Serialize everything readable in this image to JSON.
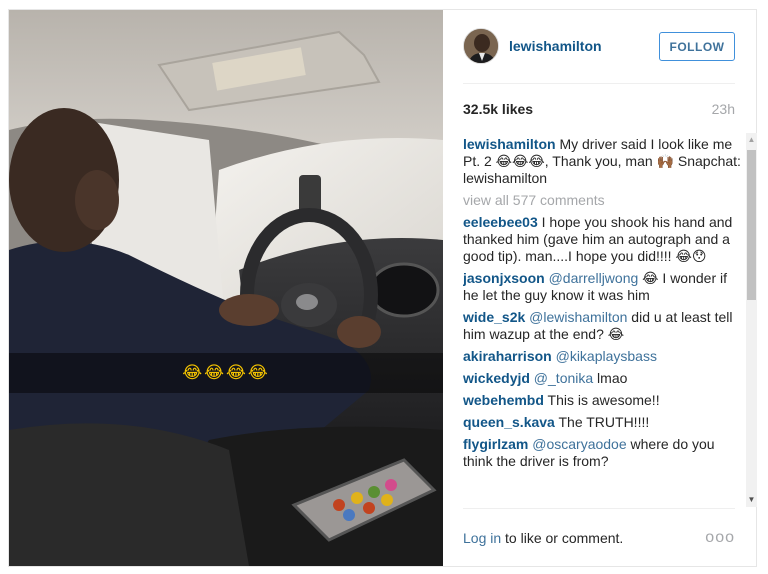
{
  "post": {
    "username": "lewishamilton",
    "follow_label": "FOLLOW",
    "likes": "32.5k likes",
    "time_ago": "23h",
    "video_caption": "😂😂😂😂"
  },
  "caption": {
    "username": "lewishamilton",
    "text": " My driver said I look like me Pt. 2 😂😂😂, Thank you, man 🙌🏾 Snapchat: lewishamilton"
  },
  "view_all_label": "view all 577 comments",
  "comments": [
    {
      "user": "eeleebee03",
      "mention": "",
      "text": " I hope you shook his hand and thanked him (gave him an autograph and a good tip). man....I hope you did!!!! 😂😯"
    },
    {
      "user": "jasonjxsoon",
      "mention": " @darrelljwong",
      "text": " 😂 I wonder if he let the guy know it was him"
    },
    {
      "user": "wide_s2k",
      "mention": " @lewishamilton",
      "text": " did u at least tell him wazup at the end? 😂"
    },
    {
      "user": "akiraharrison",
      "mention": " @kikaplaysbass",
      "text": ""
    },
    {
      "user": "wickedyjd",
      "mention": " @_tonika",
      "text": " lmao"
    },
    {
      "user": "webehembd",
      "mention": "",
      "text": " This is awesome!!"
    },
    {
      "user": "queen_s.kava",
      "mention": "",
      "text": " The TRUTH!!!!"
    },
    {
      "user": "flygirlzam",
      "mention": " @oscaryaodoe",
      "text": " where do you think the driver is from?"
    }
  ],
  "footer": {
    "login_label": "Log in",
    "login_suffix": " to like or comment.",
    "more_label": "ooo"
  },
  "colors": {
    "username": "#125688",
    "link": "#3f729b",
    "muted": "#a5a7aa",
    "caption_emoji": "#f5c400"
  },
  "icons": {
    "more": "more-options-icon",
    "scroll_up": "scroll-up-arrow-icon",
    "scroll_down": "scroll-down-arrow-icon"
  }
}
